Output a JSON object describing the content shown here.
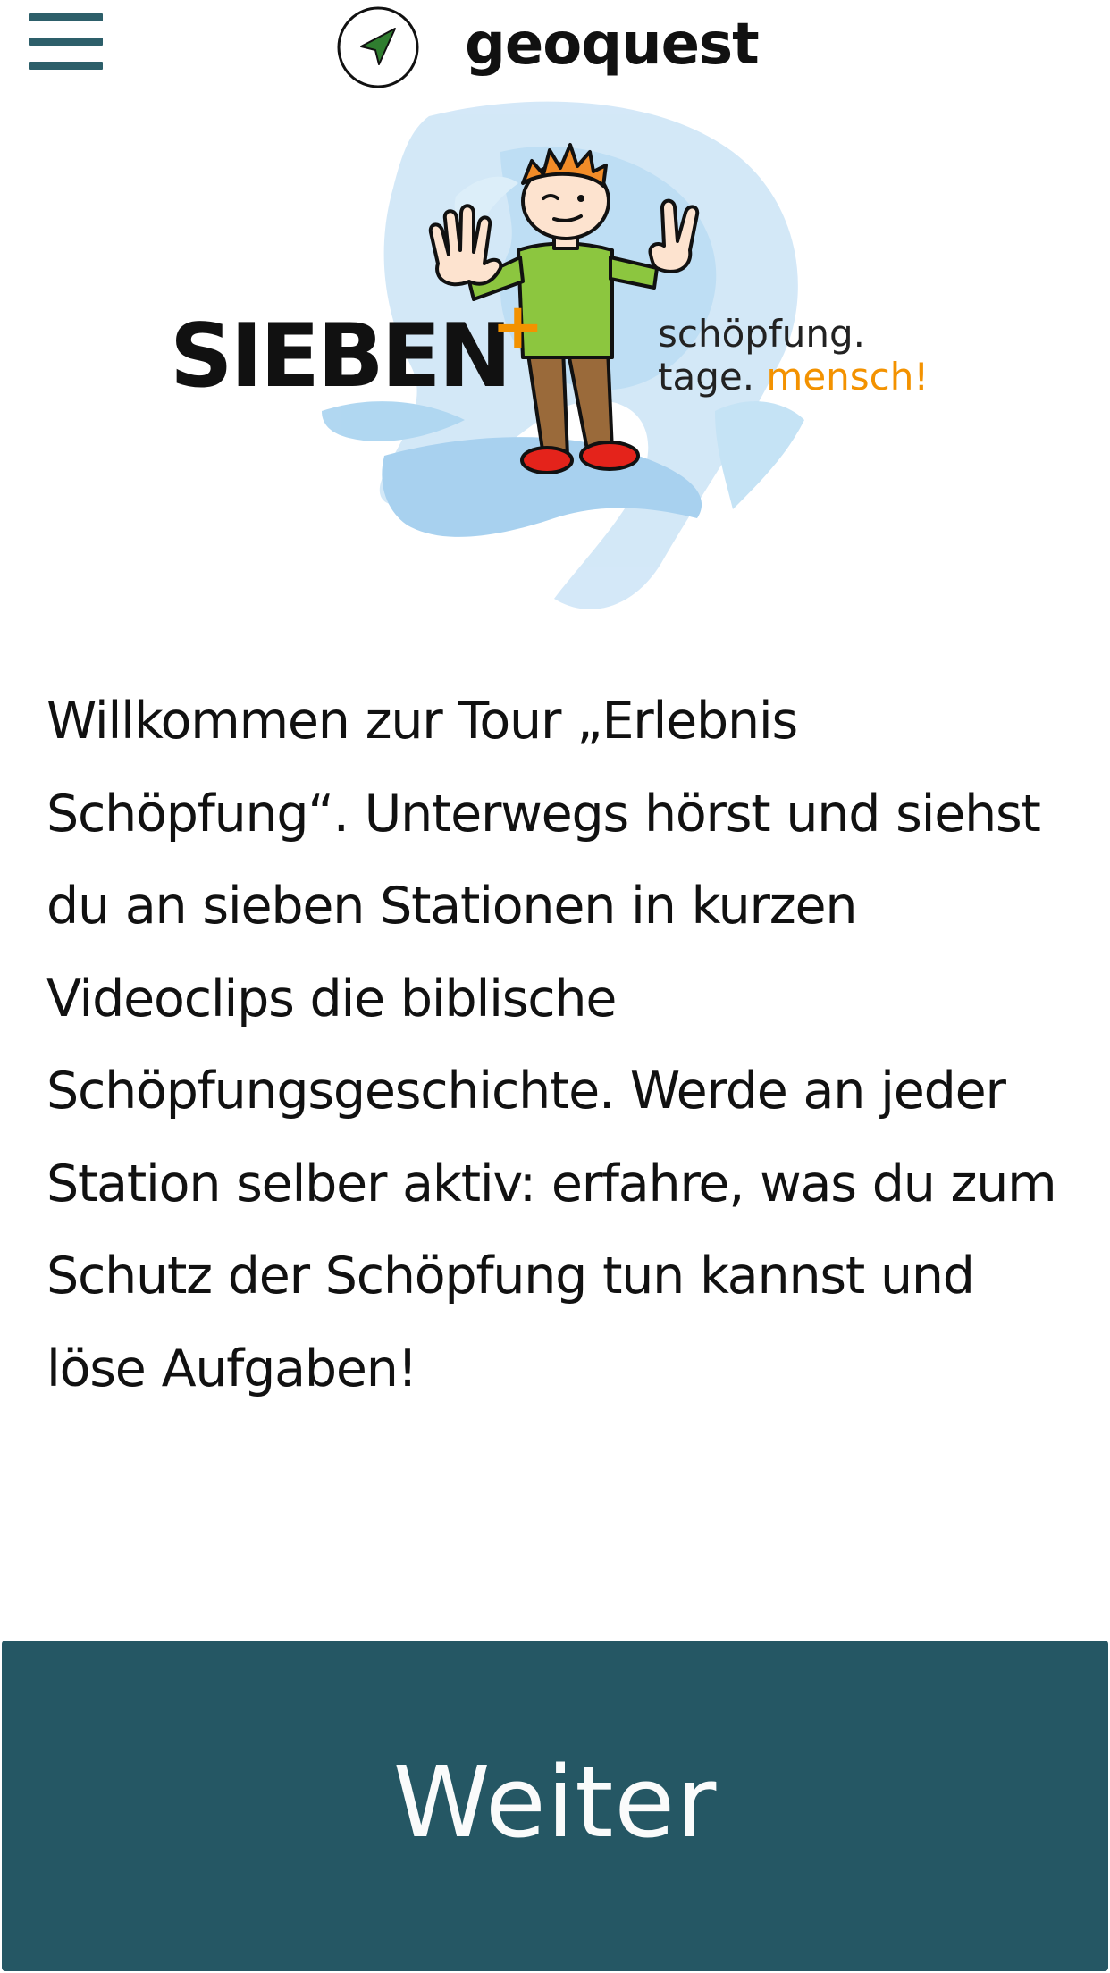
{
  "header": {
    "menu_icon": "hamburger-menu-icon",
    "brand_icon": "navigation-arrow-icon",
    "brand_name": "geoquest",
    "brand_color": "#2d5f6a",
    "arrow_color": "#2f7d2f"
  },
  "logo": {
    "word": "SIEBEN",
    "plus": "+",
    "tagline_line1": "schöpfung.",
    "tagline_line2_part1": "tage.",
    "tagline_line2_part2": "mensch!",
    "accent_color": "#f39200",
    "swirl_color": "#a8d3f0"
  },
  "intro": {
    "text": "Willkommen zur Tour „Erlebnis Schöpfung“. Unterwegs hörst und siehst du an sieben Stationen in kurzen Videoclips die biblische Schöpfungsgeschichte. Werde an jeder Station selber aktiv: erfahre, was du zum Schutz der Schöpfung tun kannst und löse Aufgaben!"
  },
  "actions": {
    "continue_label": "Weiter",
    "button_color": "#255764"
  }
}
